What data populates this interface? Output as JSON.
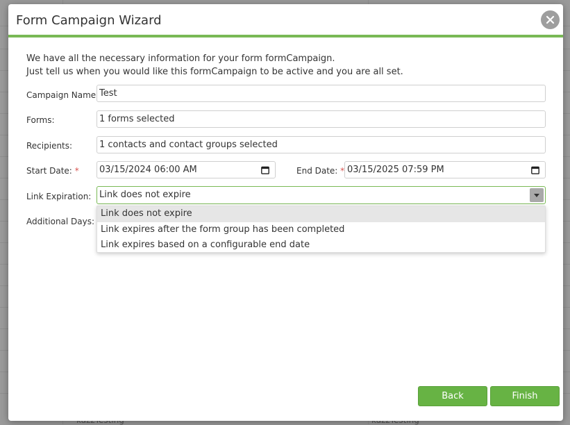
{
  "dialog": {
    "title": "Form Campaign Wizard",
    "intro_line1": "We have all the necessary information for your form formCampaign.",
    "intro_line2": "Just tell us when you would like this formCampaign to be active and you are all set."
  },
  "form": {
    "campaign_name": {
      "label": "Campaign Name:",
      "value": "Test"
    },
    "forms": {
      "label": "Forms:",
      "value": "1 forms selected"
    },
    "recipients": {
      "label": "Recipients:",
      "value": "1 contacts and contact groups selected"
    },
    "start_date": {
      "label": "Start Date:",
      "required_mark": "*",
      "value": "03/15/2024 06:00 AM"
    },
    "end_date": {
      "label": "End Date:",
      "required_mark": "*",
      "value": "03/15/2025 07:59 PM"
    },
    "link_expiration": {
      "label": "Link Expiration:",
      "value": "Link does not expire",
      "options": [
        "Link does not expire",
        "Link expires after the form group has been completed",
        "Link expires based on a configurable end date"
      ]
    },
    "additional_days": {
      "label": "Additional Days:"
    }
  },
  "buttons": {
    "back": "Back",
    "finish": "Finish"
  },
  "background": {
    "cell_left": "kazzTesting",
    "cell_right": "kazzTesting"
  },
  "colors": {
    "accent": "#79b955",
    "button": "#67b344",
    "required": "#d9534f"
  },
  "icons": {
    "close": "close-icon",
    "calendar": "calendar-icon",
    "dropdown": "chevron-down-icon"
  }
}
